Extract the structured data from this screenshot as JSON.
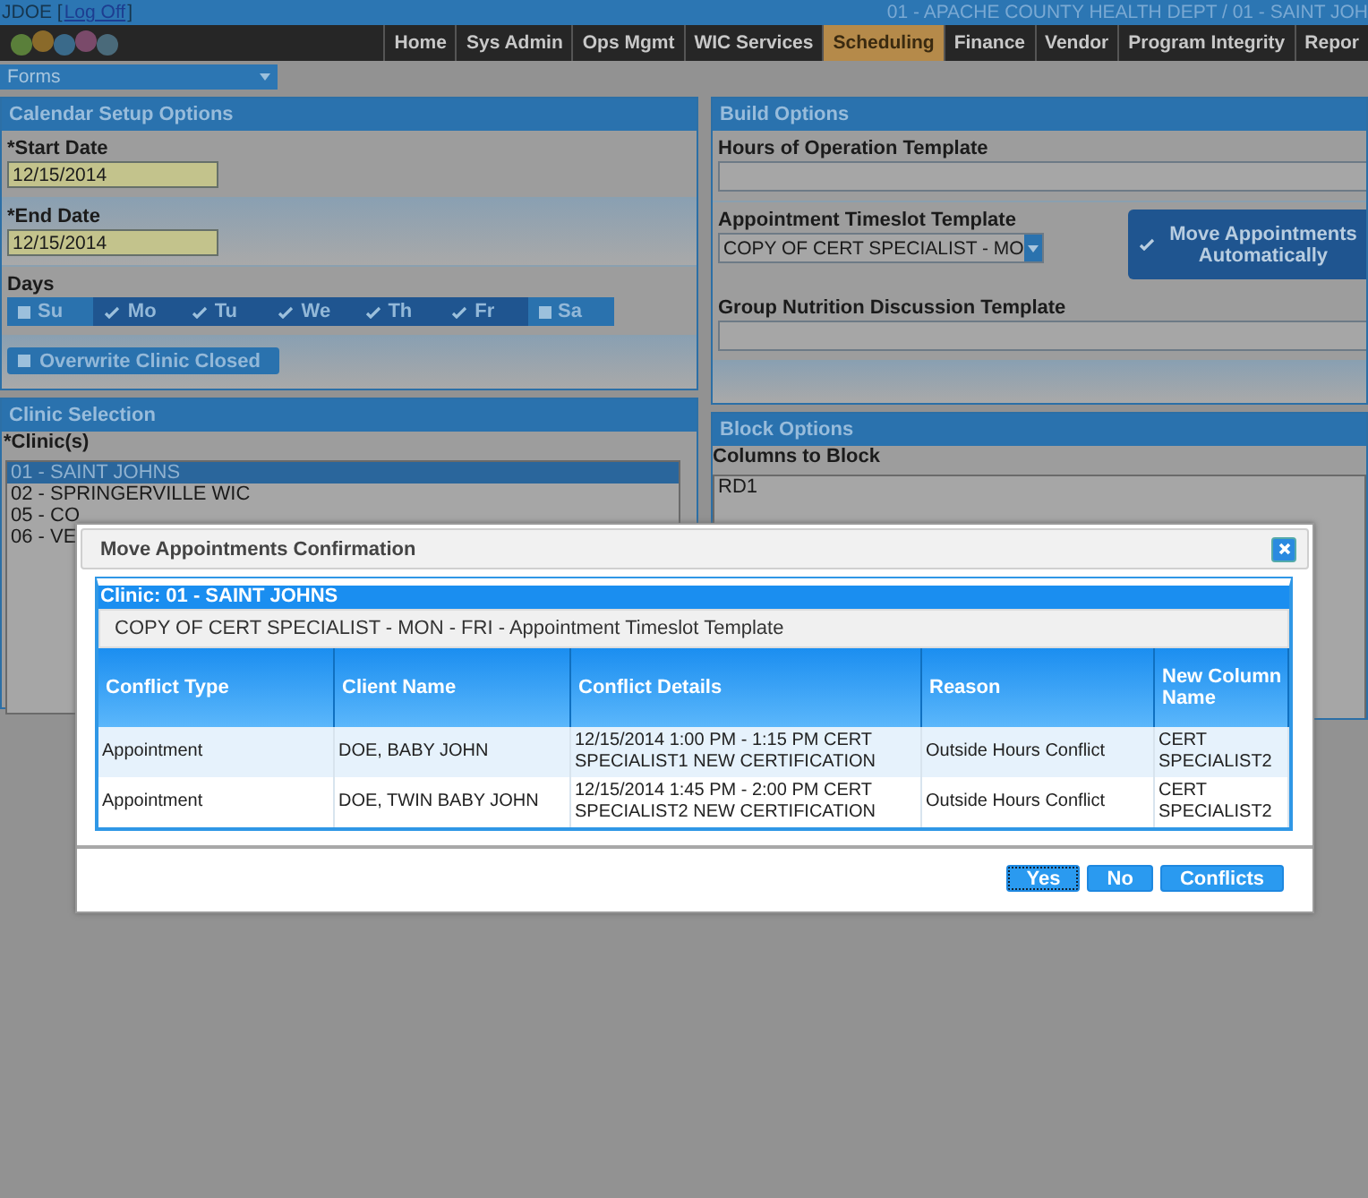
{
  "top_bar": {
    "user": "JDOE [",
    "logoff_link": "Log Off",
    "user_end": "]",
    "location": "01 - APACHE COUNTY HEALTH DEPT / 01 - SAINT JOH"
  },
  "nav_tabs": [
    {
      "label": "Home",
      "selected": false
    },
    {
      "label": "Sys Admin",
      "selected": false
    },
    {
      "label": "Ops Mgmt",
      "selected": false
    },
    {
      "label": "WIC Services",
      "selected": false
    },
    {
      "label": "Scheduling",
      "selected": true
    },
    {
      "label": "Finance",
      "selected": false
    },
    {
      "label": "Vendor",
      "selected": false
    },
    {
      "label": "Program Integrity",
      "selected": false
    },
    {
      "label": "Repor",
      "selected": false
    }
  ],
  "forms_menu": {
    "label": "Forms"
  },
  "calendar_setup": {
    "title": "Calendar Setup Options",
    "start_date": {
      "label": "*Start Date",
      "value": "12/15/2014"
    },
    "end_date": {
      "label": "*End Date",
      "value": "12/15/2014"
    },
    "days_label": "Days",
    "days": [
      {
        "label": "Su",
        "checked": false
      },
      {
        "label": "Mo",
        "checked": true
      },
      {
        "label": "Tu",
        "checked": true
      },
      {
        "label": "We",
        "checked": true
      },
      {
        "label": "Th",
        "checked": true
      },
      {
        "label": "Fr",
        "checked": true
      },
      {
        "label": "Sa",
        "checked": false
      }
    ],
    "overwrite_clinic_closed": {
      "label": "Overwrite Clinic Closed",
      "checked": false
    }
  },
  "clinic_selection": {
    "title": "Clinic Selection",
    "label": "*Clinic(s)",
    "clinics": [
      {
        "label": "01 - SAINT JOHNS",
        "selected": true
      },
      {
        "label": "02 - SPRINGERVILLE WIC",
        "selected": false
      },
      {
        "label": "05 - CO",
        "selected": false
      },
      {
        "label": "06 - VE",
        "selected": false
      }
    ]
  },
  "build_options": {
    "title": "Build Options",
    "hours_template": {
      "label": "Hours of Operation Template"
    },
    "timeslot_template": {
      "label": "Appointment Timeslot Template",
      "value": "COPY OF CERT SPECIALIST - MO"
    },
    "move_automatically": {
      "label": "Move Appointments Automatically",
      "checked": true
    },
    "group_nutrition_template": {
      "label": "Group Nutrition Discussion Template"
    }
  },
  "block_options": {
    "title": "Block Options",
    "label": "Columns to Block",
    "columns": [
      {
        "label": "RD1"
      }
    ]
  },
  "dialog": {
    "title": "Move Appointments Confirmation",
    "clinic": "Clinic: 01 - SAINT JOHNS",
    "template": "COPY OF CERT SPECIALIST - MON - FRI - Appointment Timeslot Template",
    "table": {
      "columns": [
        "Conflict Type",
        "Client Name",
        "Conflict Details",
        "Reason",
        "New Column Name"
      ],
      "rows": [
        [
          "Appointment",
          "DOE, BABY JOHN",
          "12/15/2014 1:00 PM - 1:15 PM CERT SPECIALIST1 NEW CERTIFICATION",
          "Outside Hours Conflict",
          "CERT SPECIALIST2"
        ],
        [
          "Appointment",
          "DOE, TWIN BABY JOHN",
          "12/15/2014 1:45 PM - 2:00 PM CERT SPECIALIST2 NEW CERTIFICATION",
          "Outside Hours Conflict",
          "CERT SPECIALIST2"
        ]
      ]
    },
    "buttons": [
      {
        "label": "Yes",
        "focused": true
      },
      {
        "label": "No",
        "focused": false
      },
      {
        "label": "Conflicts",
        "focused": false
      }
    ]
  }
}
